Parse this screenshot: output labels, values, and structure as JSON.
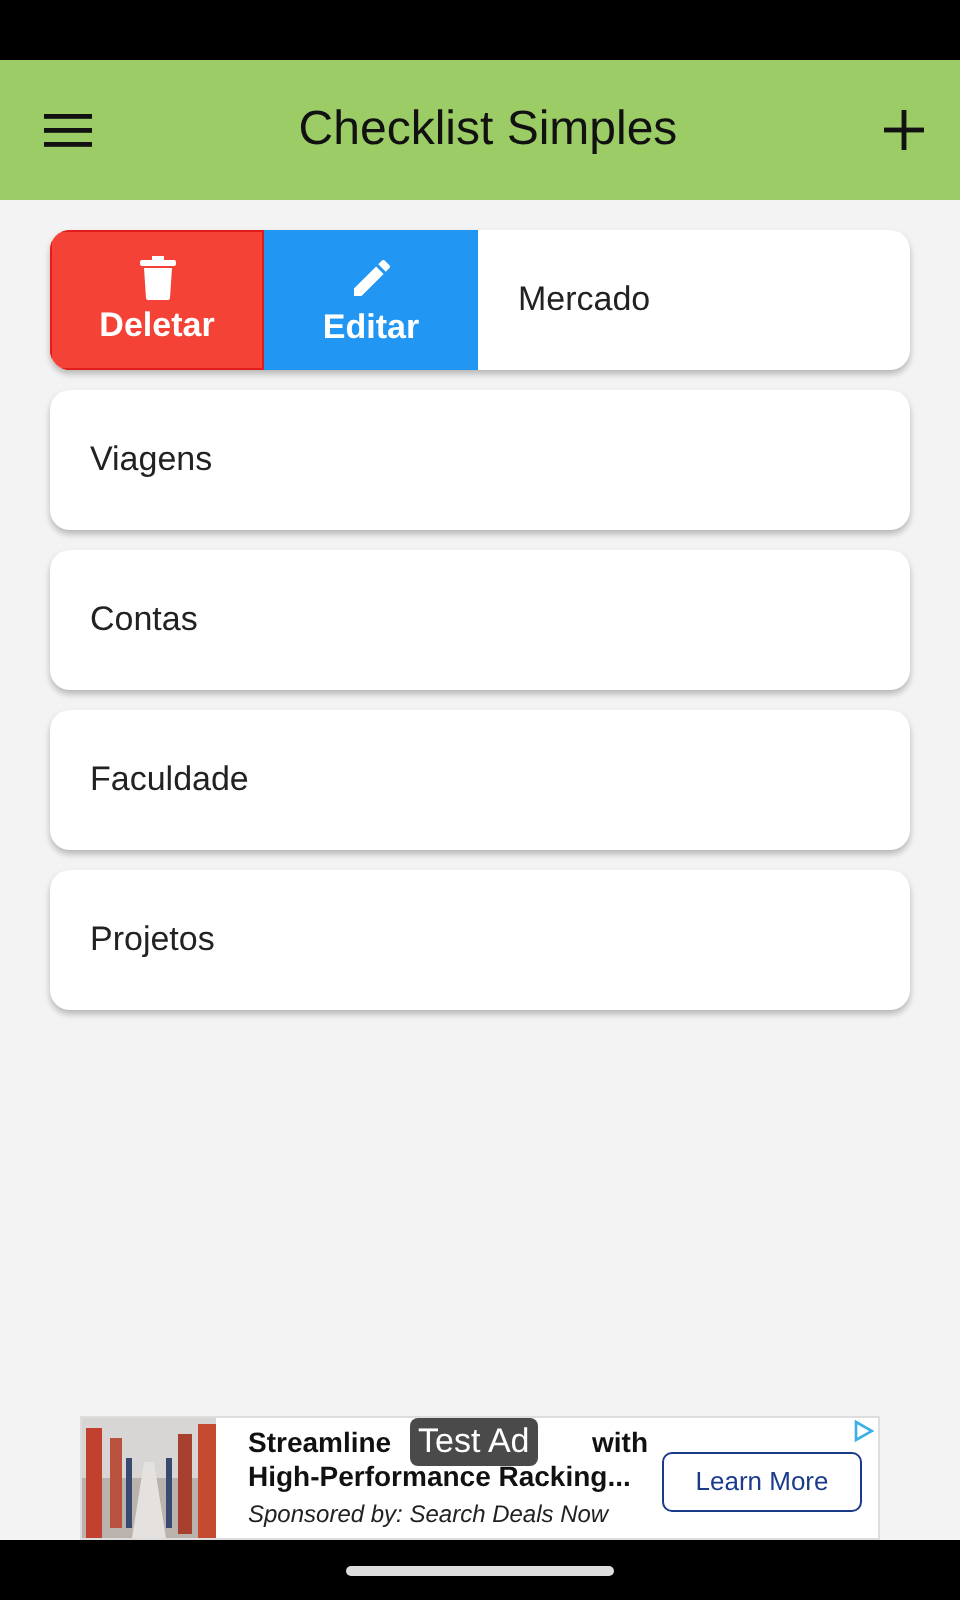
{
  "app_bar": {
    "title": "Checklist Simples"
  },
  "lists": [
    {
      "title": "Mercado",
      "actions": [
        {
          "kind": "delete",
          "label": "Deletar"
        },
        {
          "kind": "edit",
          "label": "Editar"
        }
      ]
    },
    {
      "title": "Viagens"
    },
    {
      "title": "Contas"
    },
    {
      "title": "Faculdade"
    },
    {
      "title": "Projetos"
    }
  ],
  "ad": {
    "badge": "Test Ad",
    "headline_start": "Streamline",
    "headline_end": "with",
    "headline_line2": "High-Performance Racking...",
    "sponsor": "Sponsored by: Search Deals Now",
    "button": "Learn More"
  }
}
